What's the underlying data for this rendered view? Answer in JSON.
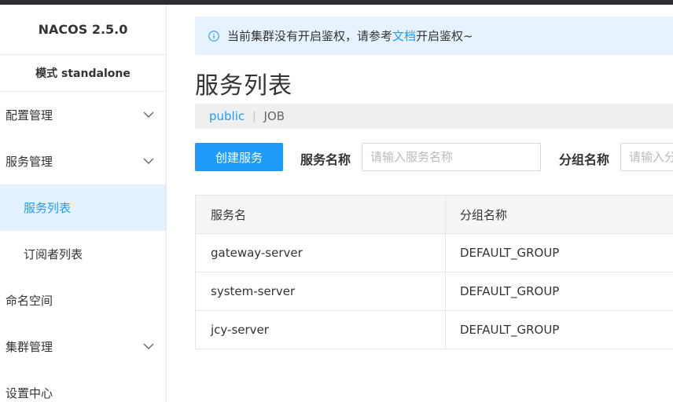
{
  "sidebar": {
    "brand": "NACOS 2.5.0",
    "mode": "模式 standalone",
    "items": [
      {
        "label": "配置管理",
        "icon": "chevron-down-icon"
      },
      {
        "label": "服务管理",
        "icon": "chevron-down-icon"
      },
      {
        "label": "服务列表"
      },
      {
        "label": "订阅者列表"
      },
      {
        "label": "命名空间"
      },
      {
        "label": "集群管理",
        "icon": "chevron-down-icon"
      },
      {
        "label": "设置中心"
      }
    ]
  },
  "notice": {
    "text_before": "当前集群没有开启鉴权，请参考",
    "link": "文档",
    "text_after": "开启鉴权~",
    "icon": "info-icon"
  },
  "page": {
    "title": "服务列表"
  },
  "namespaces": {
    "items": [
      "public",
      "JOB"
    ],
    "separator": "|"
  },
  "filters": {
    "create_button": "创建服务",
    "service_name_label": "服务名称",
    "service_name_placeholder": "请输入服务名称",
    "group_name_label": "分组名称",
    "group_name_placeholder": "请输入分组名称"
  },
  "table": {
    "headers": [
      "服务名",
      "分组名称"
    ],
    "rows": [
      [
        "gateway-server",
        "DEFAULT_GROUP"
      ],
      [
        "system-server",
        "DEFAULT_GROUP"
      ],
      [
        "jcy-server",
        "DEFAULT_GROUP"
      ]
    ]
  },
  "colors": {
    "accent": "#209bfa",
    "active_bg": "#e3f1fd",
    "notice_bg": "#e6f3fe"
  }
}
